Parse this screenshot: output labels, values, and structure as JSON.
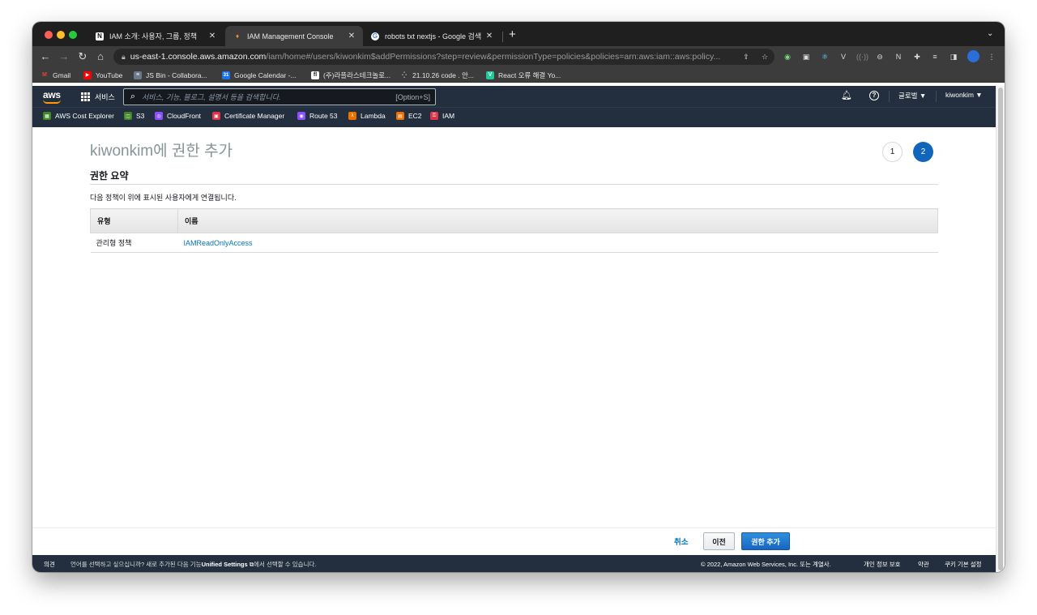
{
  "browser": {
    "tabs": [
      {
        "label": "IAM 소개: 사용자, 그룹, 정책",
        "favicon": "notion-icon",
        "active": false
      },
      {
        "label": "IAM Management Console",
        "favicon": "aws-iam-icon",
        "active": true
      },
      {
        "label": "robots txt nextjs - Google 검색",
        "favicon": "google-icon",
        "active": false
      }
    ],
    "new_tab": "+",
    "url_host": "us-east-1.console.aws.amazon.com",
    "url_path": "/iam/home#/users/kiwonkim$addPermissions?step=review&permissionType=policies&policies=arn:aws:iam::aws:policy...",
    "bookmarks": [
      {
        "label": "Gmail",
        "color": "#ea4335",
        "glyph": "M"
      },
      {
        "label": "YouTube",
        "color": "#ff0000",
        "glyph": "▶"
      },
      {
        "label": "JS Bin - Collabora...",
        "color": "#6b7b8c",
        "glyph": "≡"
      },
      {
        "label": "Google Calendar -...",
        "color": "#1a73e8",
        "glyph": "31"
      },
      {
        "label": "(주)라플라스테크놀로...",
        "color": "#222222",
        "glyph": "fl"
      },
      {
        "label": "21.10.26 code . 안...",
        "color": "#555555",
        "glyph": "·"
      },
      {
        "label": "React 오류 해결 Yo...",
        "color": "#20c997",
        "glyph": "V"
      }
    ]
  },
  "aws_nav": {
    "logo": "aws",
    "services": "서비스",
    "search_placeholder": "서비스, 기능, 블로그, 설명서 등을 검색합니다.",
    "search_shortcut": "[Option+S]",
    "region": "글로벌 ▼",
    "user": "kiwonkim ▼",
    "favorites": [
      {
        "label": "AWS Cost Explorer",
        "color": "#3f8624"
      },
      {
        "label": "S3",
        "color": "#3f8624"
      },
      {
        "label": "CloudFront",
        "color": "#8c4fff"
      },
      {
        "label": "Certificate Manager",
        "color": "#dd344c"
      },
      {
        "label": "Route 53",
        "color": "#8c4fff"
      },
      {
        "label": "Lambda",
        "color": "#ed7100"
      },
      {
        "label": "EC2",
        "color": "#ed7100"
      },
      {
        "label": "IAM",
        "color": "#dd344c"
      }
    ]
  },
  "page": {
    "title": "kiwonkim에 권한 추가",
    "steps": [
      "1",
      "2"
    ],
    "section_title": "권한 요약",
    "description": "다음 정책이 위에 표시된 사용자에게 연결됩니다.",
    "table": {
      "headers": [
        "유형",
        "이름"
      ],
      "rows": [
        {
          "type": "관리형 정책",
          "name": "IAMReadOnlyAccess"
        }
      ]
    }
  },
  "actions": {
    "cancel": "취소",
    "previous": "이전",
    "add_permissions": "권한 추가"
  },
  "footer": {
    "feedback": "의견",
    "language_prefix": "언어를 선택하고 싶으십니까? 새로 추가된 다음 기능",
    "language_link": "Unified Settings",
    "language_suffix": "에서 선택할 수 있습니다.",
    "copyright": "© 2022, Amazon Web Services, Inc. 또는 계열사.",
    "privacy": "개인 정보 보호",
    "terms": "약관",
    "cookies": "쿠키 기본 설정"
  }
}
